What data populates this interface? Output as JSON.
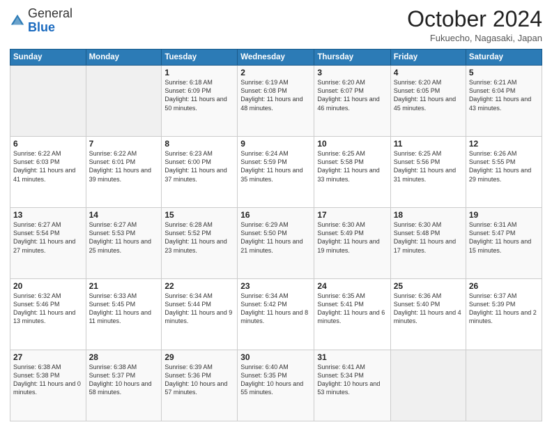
{
  "logo": {
    "general": "General",
    "blue": "Blue"
  },
  "header": {
    "month": "October 2024",
    "location": "Fukuecho, Nagasaki, Japan"
  },
  "weekdays": [
    "Sunday",
    "Monday",
    "Tuesday",
    "Wednesday",
    "Thursday",
    "Friday",
    "Saturday"
  ],
  "weeks": [
    [
      {
        "day": "",
        "sunrise": "",
        "sunset": "",
        "daylight": "",
        "empty": true
      },
      {
        "day": "",
        "sunrise": "",
        "sunset": "",
        "daylight": "",
        "empty": true
      },
      {
        "day": "1",
        "sunrise": "Sunrise: 6:18 AM",
        "sunset": "Sunset: 6:09 PM",
        "daylight": "Daylight: 11 hours and 50 minutes."
      },
      {
        "day": "2",
        "sunrise": "Sunrise: 6:19 AM",
        "sunset": "Sunset: 6:08 PM",
        "daylight": "Daylight: 11 hours and 48 minutes."
      },
      {
        "day": "3",
        "sunrise": "Sunrise: 6:20 AM",
        "sunset": "Sunset: 6:07 PM",
        "daylight": "Daylight: 11 hours and 46 minutes."
      },
      {
        "day": "4",
        "sunrise": "Sunrise: 6:20 AM",
        "sunset": "Sunset: 6:05 PM",
        "daylight": "Daylight: 11 hours and 45 minutes."
      },
      {
        "day": "5",
        "sunrise": "Sunrise: 6:21 AM",
        "sunset": "Sunset: 6:04 PM",
        "daylight": "Daylight: 11 hours and 43 minutes."
      }
    ],
    [
      {
        "day": "6",
        "sunrise": "Sunrise: 6:22 AM",
        "sunset": "Sunset: 6:03 PM",
        "daylight": "Daylight: 11 hours and 41 minutes."
      },
      {
        "day": "7",
        "sunrise": "Sunrise: 6:22 AM",
        "sunset": "Sunset: 6:01 PM",
        "daylight": "Daylight: 11 hours and 39 minutes."
      },
      {
        "day": "8",
        "sunrise": "Sunrise: 6:23 AM",
        "sunset": "Sunset: 6:00 PM",
        "daylight": "Daylight: 11 hours and 37 minutes."
      },
      {
        "day": "9",
        "sunrise": "Sunrise: 6:24 AM",
        "sunset": "Sunset: 5:59 PM",
        "daylight": "Daylight: 11 hours and 35 minutes."
      },
      {
        "day": "10",
        "sunrise": "Sunrise: 6:25 AM",
        "sunset": "Sunset: 5:58 PM",
        "daylight": "Daylight: 11 hours and 33 minutes."
      },
      {
        "day": "11",
        "sunrise": "Sunrise: 6:25 AM",
        "sunset": "Sunset: 5:56 PM",
        "daylight": "Daylight: 11 hours and 31 minutes."
      },
      {
        "day": "12",
        "sunrise": "Sunrise: 6:26 AM",
        "sunset": "Sunset: 5:55 PM",
        "daylight": "Daylight: 11 hours and 29 minutes."
      }
    ],
    [
      {
        "day": "13",
        "sunrise": "Sunrise: 6:27 AM",
        "sunset": "Sunset: 5:54 PM",
        "daylight": "Daylight: 11 hours and 27 minutes."
      },
      {
        "day": "14",
        "sunrise": "Sunrise: 6:27 AM",
        "sunset": "Sunset: 5:53 PM",
        "daylight": "Daylight: 11 hours and 25 minutes."
      },
      {
        "day": "15",
        "sunrise": "Sunrise: 6:28 AM",
        "sunset": "Sunset: 5:52 PM",
        "daylight": "Daylight: 11 hours and 23 minutes."
      },
      {
        "day": "16",
        "sunrise": "Sunrise: 6:29 AM",
        "sunset": "Sunset: 5:50 PM",
        "daylight": "Daylight: 11 hours and 21 minutes."
      },
      {
        "day": "17",
        "sunrise": "Sunrise: 6:30 AM",
        "sunset": "Sunset: 5:49 PM",
        "daylight": "Daylight: 11 hours and 19 minutes."
      },
      {
        "day": "18",
        "sunrise": "Sunrise: 6:30 AM",
        "sunset": "Sunset: 5:48 PM",
        "daylight": "Daylight: 11 hours and 17 minutes."
      },
      {
        "day": "19",
        "sunrise": "Sunrise: 6:31 AM",
        "sunset": "Sunset: 5:47 PM",
        "daylight": "Daylight: 11 hours and 15 minutes."
      }
    ],
    [
      {
        "day": "20",
        "sunrise": "Sunrise: 6:32 AM",
        "sunset": "Sunset: 5:46 PM",
        "daylight": "Daylight: 11 hours and 13 minutes."
      },
      {
        "day": "21",
        "sunrise": "Sunrise: 6:33 AM",
        "sunset": "Sunset: 5:45 PM",
        "daylight": "Daylight: 11 hours and 11 minutes."
      },
      {
        "day": "22",
        "sunrise": "Sunrise: 6:34 AM",
        "sunset": "Sunset: 5:44 PM",
        "daylight": "Daylight: 11 hours and 9 minutes."
      },
      {
        "day": "23",
        "sunrise": "Sunrise: 6:34 AM",
        "sunset": "Sunset: 5:42 PM",
        "daylight": "Daylight: 11 hours and 8 minutes."
      },
      {
        "day": "24",
        "sunrise": "Sunrise: 6:35 AM",
        "sunset": "Sunset: 5:41 PM",
        "daylight": "Daylight: 11 hours and 6 minutes."
      },
      {
        "day": "25",
        "sunrise": "Sunrise: 6:36 AM",
        "sunset": "Sunset: 5:40 PM",
        "daylight": "Daylight: 11 hours and 4 minutes."
      },
      {
        "day": "26",
        "sunrise": "Sunrise: 6:37 AM",
        "sunset": "Sunset: 5:39 PM",
        "daylight": "Daylight: 11 hours and 2 minutes."
      }
    ],
    [
      {
        "day": "27",
        "sunrise": "Sunrise: 6:38 AM",
        "sunset": "Sunset: 5:38 PM",
        "daylight": "Daylight: 11 hours and 0 minutes."
      },
      {
        "day": "28",
        "sunrise": "Sunrise: 6:38 AM",
        "sunset": "Sunset: 5:37 PM",
        "daylight": "Daylight: 10 hours and 58 minutes."
      },
      {
        "day": "29",
        "sunrise": "Sunrise: 6:39 AM",
        "sunset": "Sunset: 5:36 PM",
        "daylight": "Daylight: 10 hours and 57 minutes."
      },
      {
        "day": "30",
        "sunrise": "Sunrise: 6:40 AM",
        "sunset": "Sunset: 5:35 PM",
        "daylight": "Daylight: 10 hours and 55 minutes."
      },
      {
        "day": "31",
        "sunrise": "Sunrise: 6:41 AM",
        "sunset": "Sunset: 5:34 PM",
        "daylight": "Daylight: 10 hours and 53 minutes."
      },
      {
        "day": "",
        "sunrise": "",
        "sunset": "",
        "daylight": "",
        "empty": true
      },
      {
        "day": "",
        "sunrise": "",
        "sunset": "",
        "daylight": "",
        "empty": true
      }
    ]
  ]
}
